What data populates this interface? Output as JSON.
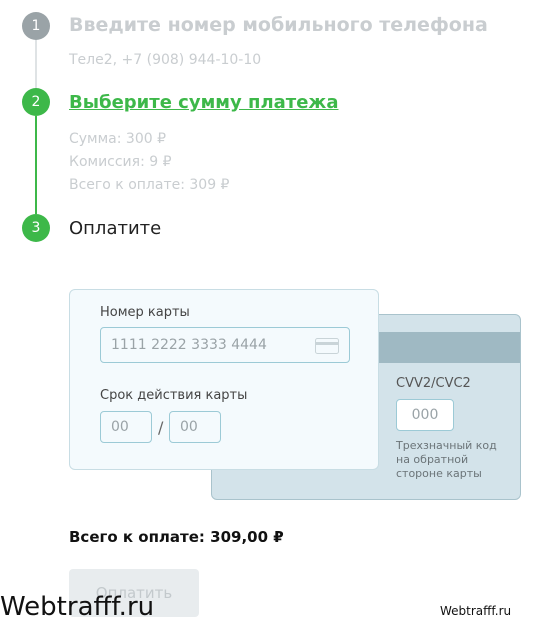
{
  "steps": [
    {
      "number": "1",
      "title": "Введите номер мобильного телефона",
      "detail": "Теле2, +7 (908) 944-10-10"
    },
    {
      "number": "2",
      "title": "Выберите сумму платежа",
      "details": [
        "Сумма: 300 ₽",
        "Комиссия: 9 ₽",
        "Всего к оплате: 309 ₽"
      ]
    },
    {
      "number": "3",
      "title": "Оплатите"
    }
  ],
  "card_front": {
    "number_label": "Номер карты",
    "number_placeholder": "1111 2222 3333 4444",
    "expiry_label": "Срок действия карты",
    "month_placeholder": "00",
    "year_placeholder": "00",
    "separator": "/"
  },
  "card_back": {
    "cvv_label": "CVV2/CVC2",
    "cvv_placeholder": "000",
    "hint_lines": [
      "Трехзначный код",
      "на обратной",
      "стороне карты"
    ]
  },
  "total": "Всего к оплате: 309,00 ₽",
  "pay_button": "Оплатить",
  "watermark_left": "Webtrafff.ru",
  "watermark_right": "Webtrafff.ru",
  "colors": {
    "green": "#3db849",
    "gray_step": "#9aa3a7",
    "card_back": "#d3e3ea",
    "card_stripe": "#9fb9c3"
  }
}
